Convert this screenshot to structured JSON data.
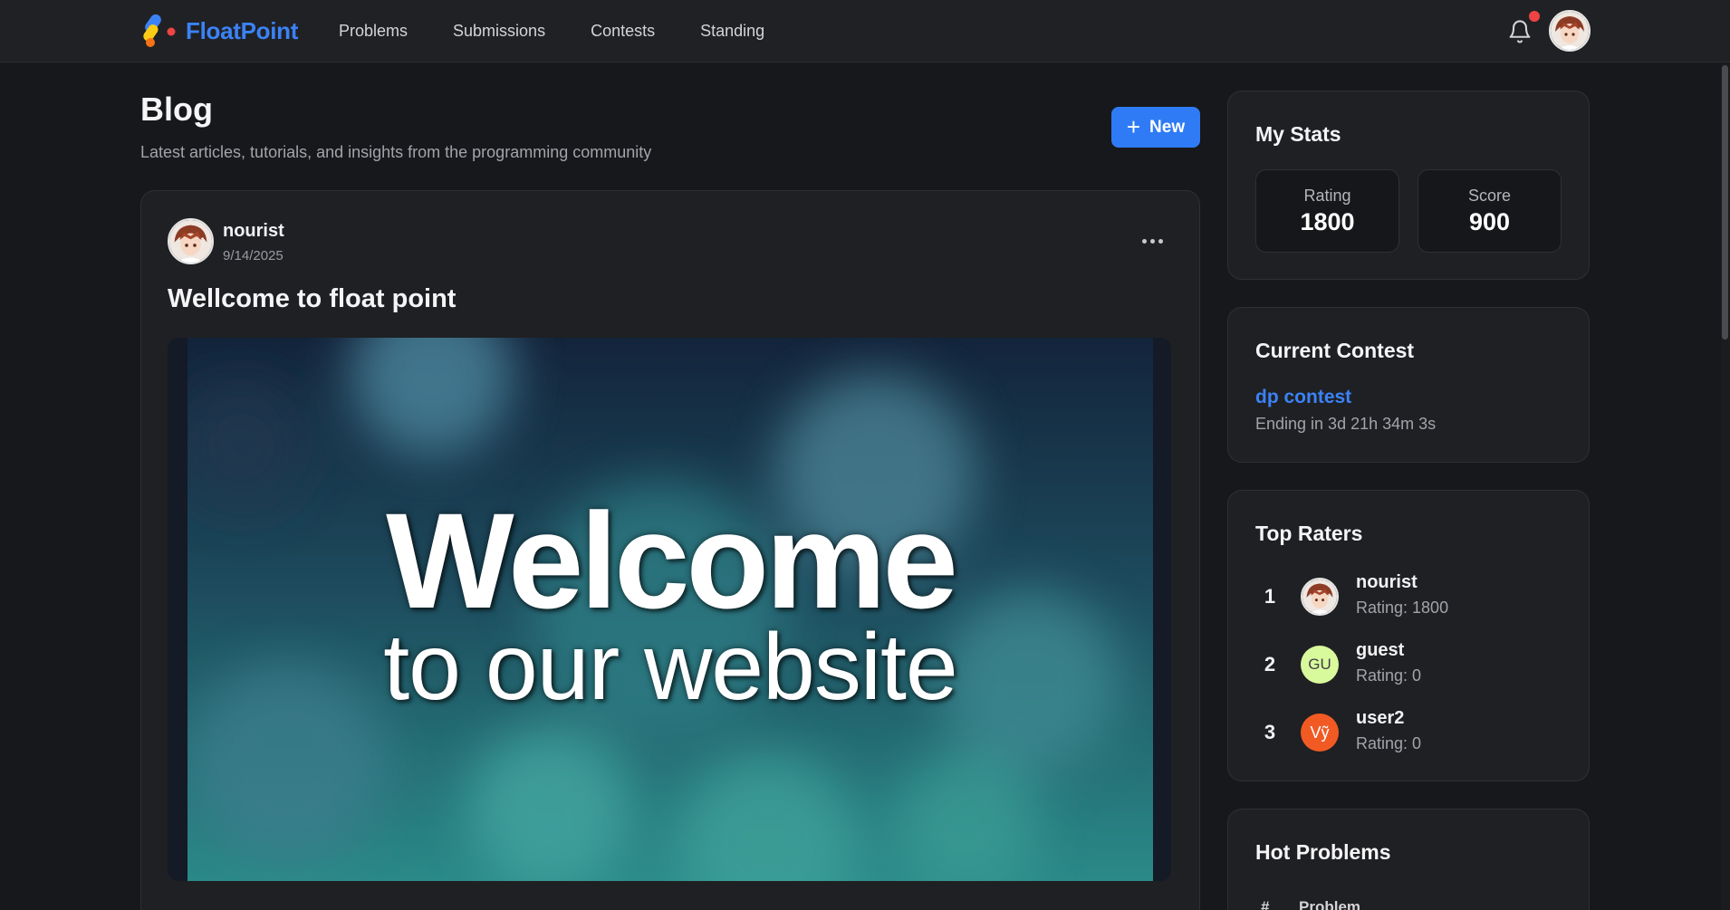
{
  "nav": {
    "brand": "FloatPoint",
    "links": [
      "Problems",
      "Submissions",
      "Contests",
      "Standing"
    ]
  },
  "blog": {
    "title": "Blog",
    "subtitle": "Latest articles, tutorials, and insights from the programming community",
    "new_button": "New"
  },
  "post": {
    "author": "nourist",
    "date": "9/14/2025",
    "title": "Wellcome to float point",
    "image_text_line1": "Welcome",
    "image_text_line2": "to our  website"
  },
  "stats": {
    "title": "My Stats",
    "rating_label": "Rating",
    "rating_value": "1800",
    "score_label": "Score",
    "score_value": "900"
  },
  "contest": {
    "title": "Current Contest",
    "name": "dp contest",
    "ending": "Ending in 3d 21h 34m 3s"
  },
  "raters": {
    "title": "Top Raters",
    "items": [
      {
        "rank": "1",
        "name": "nourist",
        "rating": "Rating: 1800",
        "initials": ""
      },
      {
        "rank": "2",
        "name": "guest",
        "rating": "Rating: 0",
        "initials": "GU"
      },
      {
        "rank": "3",
        "name": "user2",
        "rating": "Rating: 0",
        "initials": "Vỹ"
      }
    ]
  },
  "hot": {
    "title": "Hot Problems",
    "col_num": "#",
    "col_problem": "Problem"
  },
  "colors": {
    "accent": "#2f7bf5",
    "brand": "#3b82f6",
    "notification": "#ef4444",
    "guest_avatar": "#d9f99d",
    "user2_avatar": "#f97316"
  }
}
